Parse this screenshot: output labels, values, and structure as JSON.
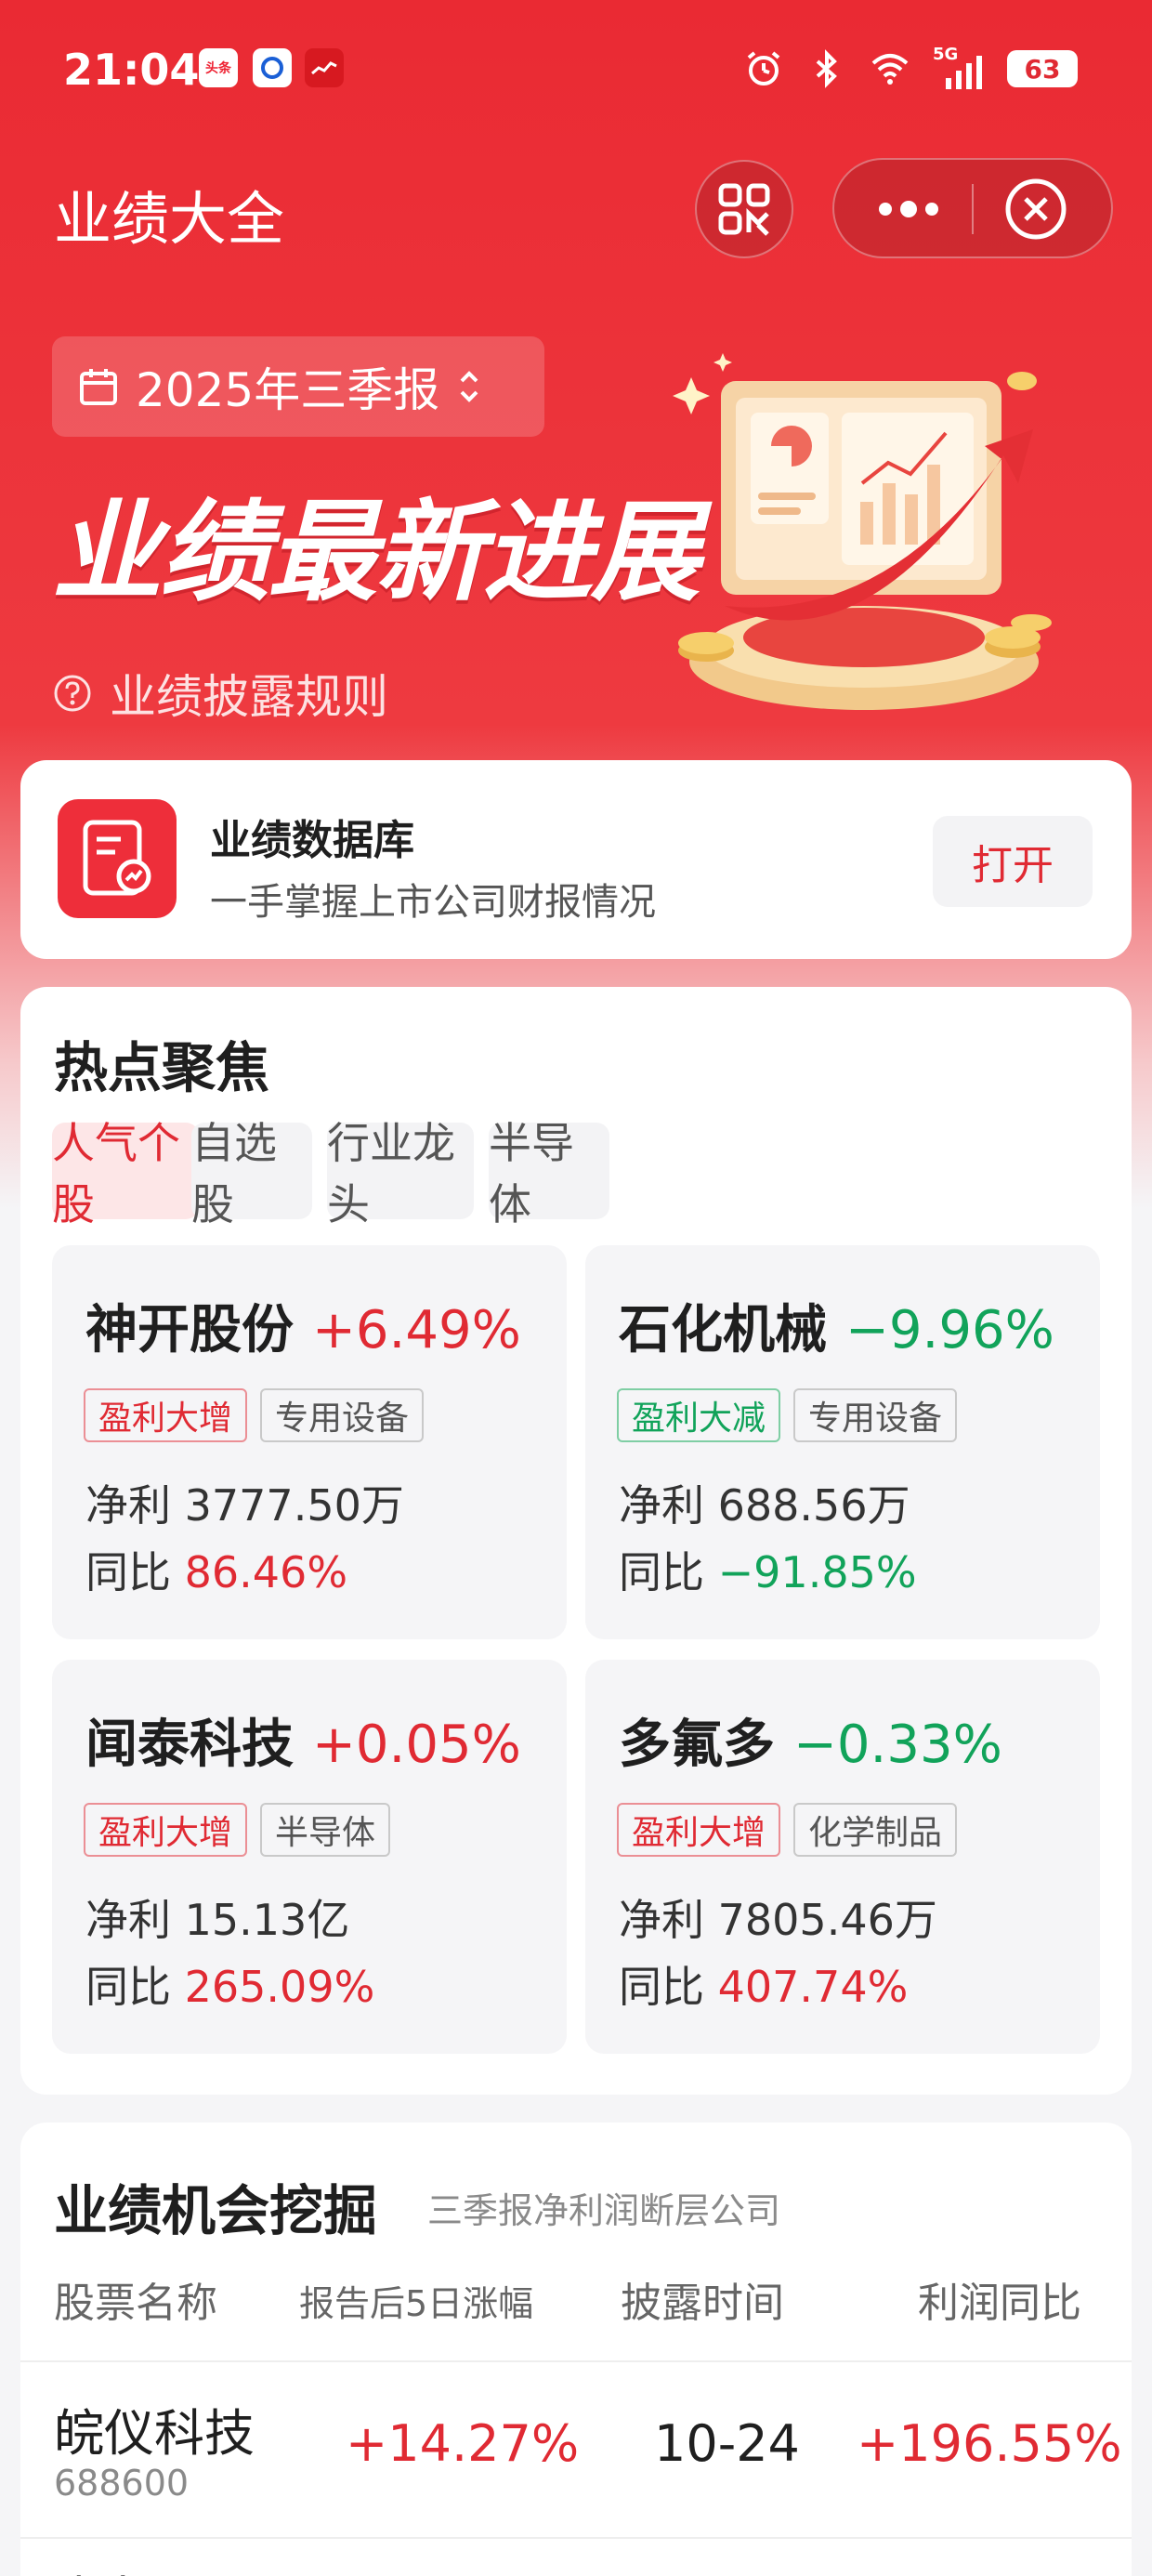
{
  "status_bar": {
    "time": "21:04",
    "apps": [
      "头条",
      "",
      ""
    ],
    "signal": "5G",
    "battery": "63"
  },
  "header": {
    "title": "业绩大全",
    "icons": [
      "qr-scan-icon",
      "more-icon",
      "close-icon"
    ]
  },
  "hero": {
    "period": "2025年三季报",
    "title": "业绩最新进展",
    "rules_link": "业绩披露规则"
  },
  "database": {
    "title": "业绩数据库",
    "subtitle": "一手掌握上市公司财报情况",
    "open_label": "打开"
  },
  "hot_focus": {
    "title": "热点聚焦",
    "tabs": [
      "人气个股",
      "自选股",
      "行业龙头",
      "半导体"
    ],
    "active_tab": 0,
    "net_profit_label": "净利",
    "yoy_label": "同比",
    "stocks": [
      {
        "name": "神开股份",
        "change": "+6.49%",
        "tag": "盈利大增",
        "industry": "专用设备",
        "net_profit": "3777.50万",
        "yoy": "86.46%"
      },
      {
        "name": "石化机械",
        "change": "−9.96%",
        "tag": "盈利大减",
        "industry": "专用设备",
        "net_profit": "688.56万",
        "yoy": "−91.85%"
      },
      {
        "name": "闻泰科技",
        "change": "+0.05%",
        "tag": "盈利大增",
        "industry": "半导体",
        "net_profit": "15.13亿",
        "yoy": "265.09%"
      },
      {
        "name": "多氟多",
        "change": "−0.33%",
        "tag": "盈利大增",
        "industry": "化学制品",
        "net_profit": "7805.46万",
        "yoy": "407.74%"
      }
    ]
  },
  "opportunities": {
    "title": "业绩机会挖掘",
    "subtitle": "三季报净利润断层公司",
    "columns": [
      "股票名称",
      "报告后5日涨幅",
      "披露时间",
      "利润同比"
    ],
    "rows": [
      {
        "name": "皖仪科技",
        "code": "688600",
        "gain_5d": "+14.27%",
        "date": "10-24",
        "profit_yoy": "+196.55%"
      }
    ],
    "next_row_name": "嘉友国"
  },
  "colors": {
    "brand_red": "#ea2a33",
    "up_red": "#e02a33",
    "down_green": "#11a35a"
  }
}
